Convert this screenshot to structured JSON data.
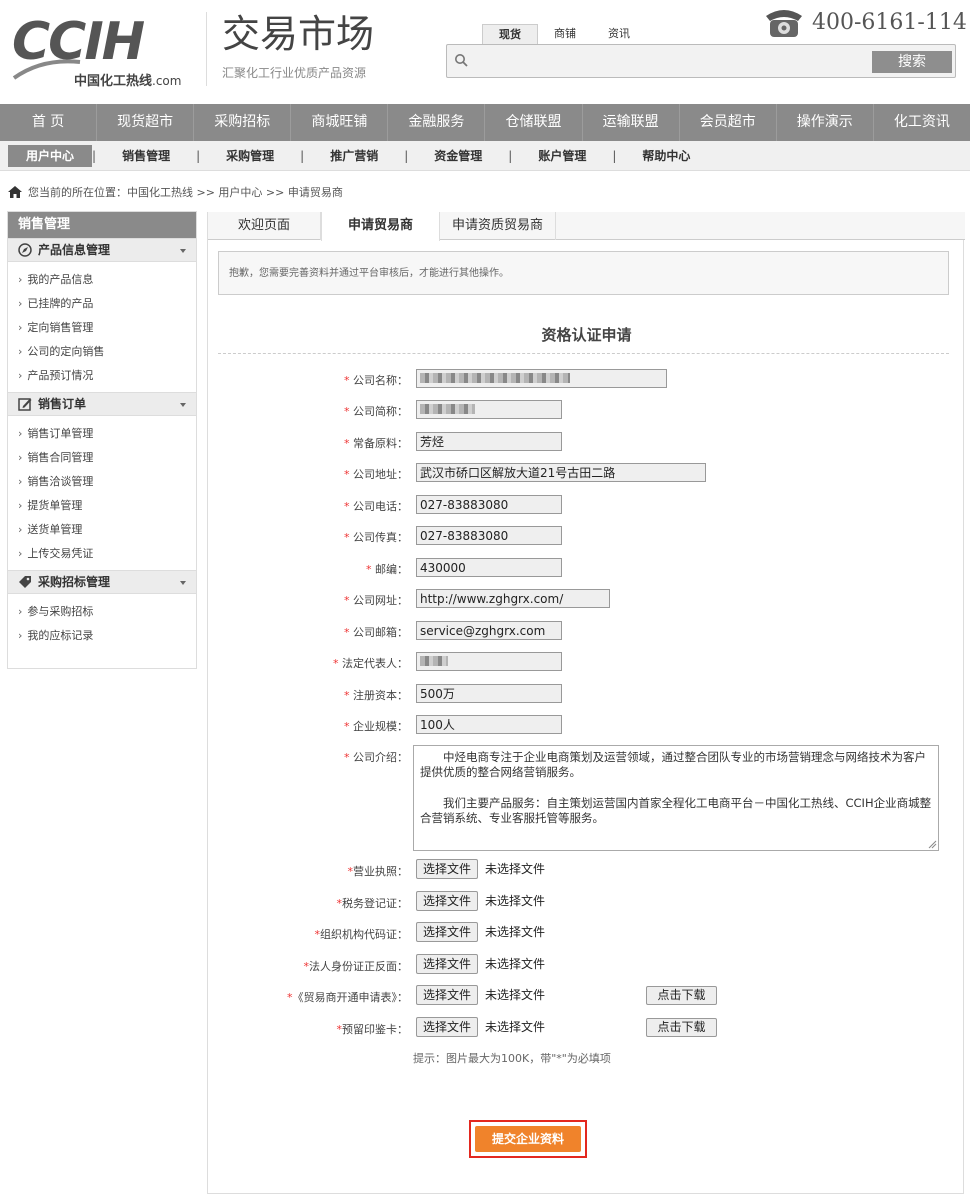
{
  "header": {
    "logo_text": "CCIH",
    "logo_sub": "中国化工热线",
    "logo_domain": ".com",
    "site_title": "交易市场",
    "site_sub": "汇聚化工行业优质产品资源",
    "search_tabs": [
      "现货",
      "商铺",
      "资讯"
    ],
    "search_placeholder": "",
    "search_button": "搜索",
    "phone": "400-6161-114"
  },
  "mainnav": [
    "首 页",
    "现货超市",
    "采购招标",
    "商城旺铺",
    "金融服务",
    "仓储联盟",
    "运输联盟",
    "会员超市",
    "操作演示",
    "化工资讯"
  ],
  "subnav": [
    "用户中心",
    "销售管理",
    "采购管理",
    "推广营销",
    "资金管理",
    "账户管理",
    "帮助中心"
  ],
  "breadcrumb": "您当前的所在位置：中国化工热线 >> 用户中心 >> 申请贸易商",
  "sidebar": {
    "title": "销售管理",
    "groups": [
      {
        "label": "产品信息管理",
        "icon": "compass-icon",
        "items": [
          "我的产品信息",
          "已挂牌的产品",
          "定向销售管理",
          "公司的定向销售",
          "产品预订情况"
        ]
      },
      {
        "label": "销售订单",
        "icon": "edit-icon",
        "items": [
          "销售订单管理",
          "销售合同管理",
          "销售洽谈管理",
          "提货单管理",
          "送货单管理",
          "上传交易凭证"
        ]
      },
      {
        "label": "采购招标管理",
        "icon": "tag-icon",
        "items": [
          "参与采购招标",
          "我的应标记录"
        ]
      }
    ]
  },
  "tabs": [
    "欢迎页面",
    "申请贸易商",
    "申请资质贸易商"
  ],
  "notice": "抱歉，您需要完善资料并通过平台审核后，才能进行其他操作。",
  "form": {
    "title": "资格认证申请",
    "fields": [
      {
        "label": "公司名称：",
        "value": ""
      },
      {
        "label": "公司简称：",
        "value": ""
      },
      {
        "label": "常备原料：",
        "value": "芳烃"
      },
      {
        "label": "公司地址：",
        "value": "武汉市硚口区解放大道21号古田二路"
      },
      {
        "label": "公司电话：",
        "value": "027-83883080"
      },
      {
        "label": "公司传真：",
        "value": "027-83883080"
      },
      {
        "label": "邮编：",
        "value": "430000"
      },
      {
        "label": "公司网址：",
        "value": "http://www.zghgrx.com/"
      },
      {
        "label": "公司邮箱：",
        "value": "service@zghgrx.com"
      },
      {
        "label": "法定代表人：",
        "value": ""
      },
      {
        "label": "注册资本：",
        "value": "500万"
      },
      {
        "label": "企业规模：",
        "value": "100人"
      }
    ],
    "intro_label": "公司介绍：",
    "intro_p1": "中烃电商专注于企业电商策划及运营领域，通过整合团队专业的市场营销理念与网络技术为客户提供优质的整合网络营销服务。",
    "intro_p2": "我们主要产品服务：自主策划运营国内首家全程化工电商平台－中国化工热线、CCIH企业商城整合营销系统、专业客服托管等服务。",
    "uploads": [
      {
        "label": "营业执照：",
        "download": ""
      },
      {
        "label": "税务登记证：",
        "download": ""
      },
      {
        "label": "组织机构代码证：",
        "download": ""
      },
      {
        "label": "法人身份证正反面：",
        "download": ""
      },
      {
        "label": "《贸易商开通申请表》：",
        "download": "点击下载"
      },
      {
        "label": "预留印鉴卡：",
        "download": "点击下载"
      }
    ],
    "choose_file": "选择文件",
    "no_file": "未选择文件",
    "hint": "提示：图片最大为100K，带\"*\"为必填项",
    "submit": "提交企业资料"
  },
  "colors": {
    "nav_bg": "#8a8a8a",
    "submit_bg": "#f0832b",
    "highlight_border": "#e3281f",
    "required_star": "#e33333"
  }
}
